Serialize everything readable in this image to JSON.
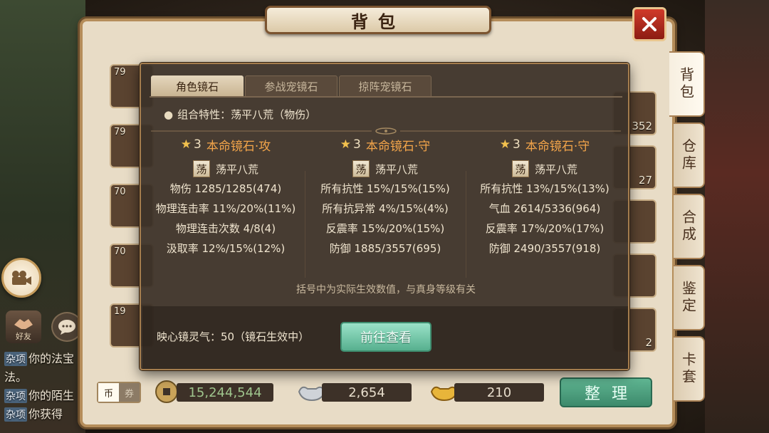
{
  "chat": {
    "friend_label": "好友",
    "lines": [
      {
        "tag": "杂项",
        "text": "你的法宝"
      },
      {
        "tag": "",
        "text": "法。"
      },
      {
        "tag": "杂项",
        "text": "你的陌生"
      },
      {
        "tag": "杂项",
        "text": "你获得"
      }
    ]
  },
  "bag": {
    "title": "背包",
    "close_icon": "close-icon",
    "side_tabs": [
      "背包",
      "仓库",
      "合成",
      "鉴定",
      "卡套"
    ],
    "grid_levels": [
      "79",
      "79",
      "70",
      "70",
      "19"
    ],
    "grid_counts": [
      "352",
      "27",
      "2"
    ],
    "currency_toggle": {
      "on": "币",
      "off": "券"
    },
    "money": {
      "copper": "15,244,544",
      "silver": "2,654",
      "gold": "210"
    },
    "sort_label": "整理"
  },
  "popup": {
    "tabs": [
      "角色镜石",
      "参战宠镜石",
      "掠阵宠镜石"
    ],
    "combo_trait": "组合特性：荡平八荒（物伤）",
    "columns": [
      {
        "stars": "3",
        "title": "本命镜石·攻",
        "badge": "荡",
        "stone_name": "荡平八荒",
        "stats": [
          "物伤 1285/1285(474)",
          "物理连击率 11%/20%(11%)",
          "物理连击次数 4/8(4)",
          "汲取率 12%/15%(12%)"
        ]
      },
      {
        "stars": "3",
        "title": "本命镜石·守",
        "badge": "荡",
        "stone_name": "荡平八荒",
        "stats": [
          "所有抗性 15%/15%(15%)",
          "所有抗异常 4%/15%(4%)",
          "反震率 15%/20%(15%)",
          "防御 1885/3557(695)"
        ]
      },
      {
        "stars": "3",
        "title": "本命镜石·守",
        "badge": "荡",
        "stone_name": "荡平八荒",
        "stats": [
          "所有抗性 13%/15%(13%)",
          "气血 2614/5336(964)",
          "反震率 17%/20%(17%)",
          "防御 2490/3557(918)"
        ]
      }
    ],
    "footnote": "括号中为实际生效数值，与真身等级有关",
    "aura_text": "映心镜灵气：50（镜石生效中）",
    "goto_label": "前往查看"
  },
  "colors": {
    "stone_title": "#f3a54a",
    "goto_button": "#57b08f",
    "close_button": "#c0301f"
  }
}
